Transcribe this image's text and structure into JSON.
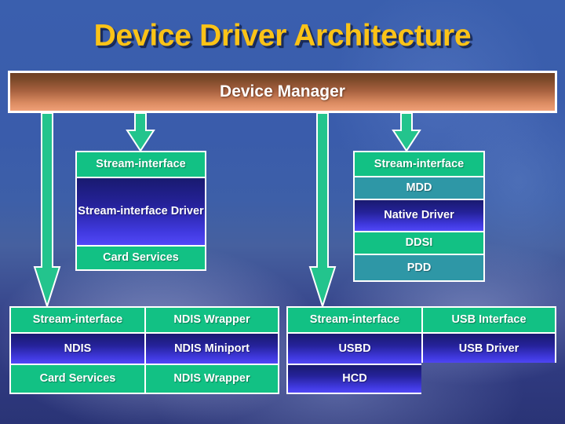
{
  "slide": {
    "title": "Device Driver Architecture",
    "background_color": "#3a5cab",
    "title_color": "#fbc317"
  },
  "device_manager": {
    "label": "Device Manager",
    "gradient_from": "#6e4024",
    "gradient_to": "#f0a077"
  },
  "palette": {
    "green": "#12c184",
    "teal": "#2e97a6",
    "blue_dark": "#191a70",
    "blue_light": "#5148f7",
    "arrow": "#23c48d",
    "border": "#ffffff"
  },
  "arrows": [
    {
      "name": "arrow-device-manager-to-pcmcia-grid",
      "length": "long"
    },
    {
      "name": "arrow-device-manager-to-stream-interface-driver",
      "length": "short"
    },
    {
      "name": "arrow-device-manager-to-usb-grid",
      "length": "long"
    },
    {
      "name": "arrow-device-manager-to-native-driver",
      "length": "short"
    }
  ],
  "stream_interface_stack": {
    "name": "stream-interface-driver-stack",
    "rows": [
      {
        "label": "Stream-interface",
        "style": "green"
      },
      {
        "label": "Stream-interface Driver",
        "style": "blue"
      },
      {
        "label": "Card Services",
        "style": "green"
      }
    ]
  },
  "native_driver_stack": {
    "name": "native-driver-stack",
    "rows": [
      {
        "label": "Stream-interface",
        "style": "green"
      },
      {
        "label": "MDD",
        "style": "teal"
      },
      {
        "label": "Native Driver",
        "style": "blue"
      },
      {
        "label": "DDSI",
        "style": "green"
      },
      {
        "label": "PDD",
        "style": "teal"
      }
    ]
  },
  "ndis_grid": {
    "name": "ndis-grid",
    "rows": [
      [
        {
          "label": "Stream-interface",
          "style": "green"
        },
        {
          "label": "NDIS Wrapper",
          "style": "green"
        }
      ],
      [
        {
          "label": "NDIS",
          "style": "blue"
        },
        {
          "label": "NDIS Miniport",
          "style": "blue"
        }
      ],
      [
        {
          "label": "Card Services",
          "style": "green"
        },
        {
          "label": "NDIS Wrapper",
          "style": "green"
        }
      ]
    ]
  },
  "usb_grid": {
    "name": "usb-grid",
    "rows": [
      [
        {
          "label": "Stream-interface",
          "style": "green"
        },
        {
          "label": "USB Interface",
          "style": "green"
        }
      ],
      [
        {
          "label": "USBD",
          "style": "blue"
        },
        {
          "label": "USB Driver",
          "style": "blue"
        }
      ],
      [
        {
          "label": "HCD",
          "style": "blue"
        },
        {
          "label": "",
          "style": "empty"
        }
      ]
    ]
  }
}
